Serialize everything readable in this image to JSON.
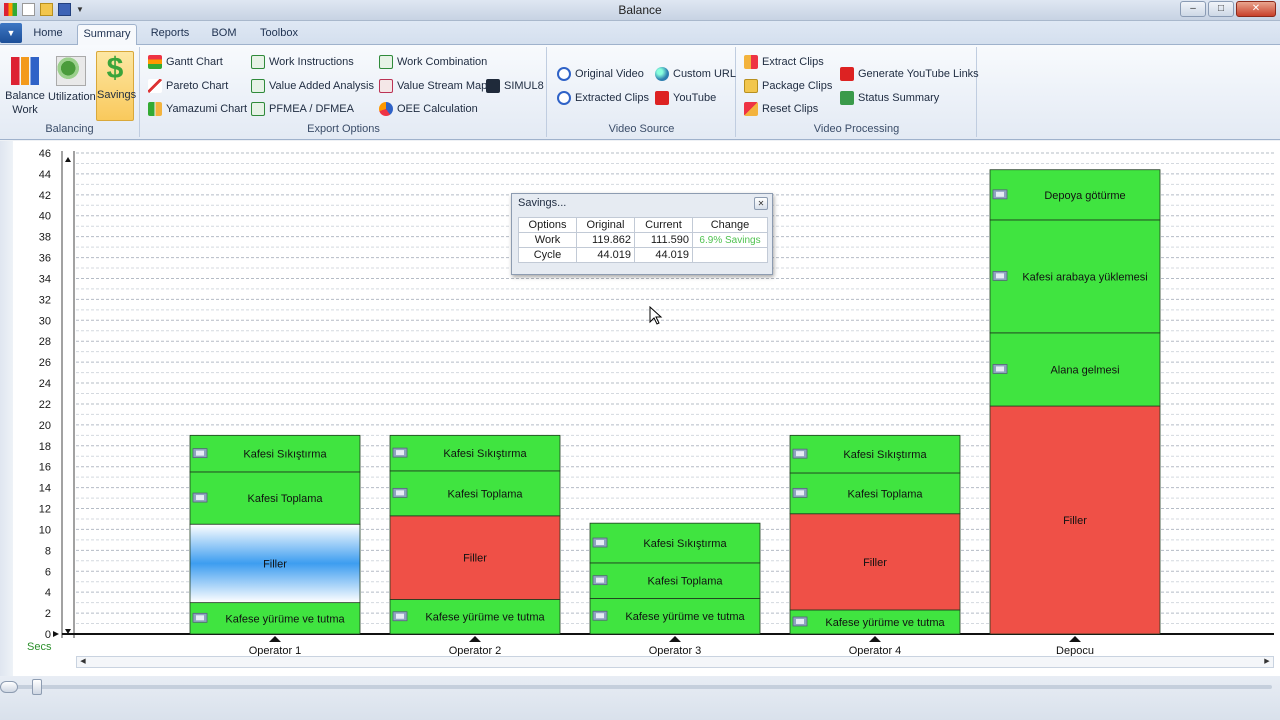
{
  "window": {
    "title": "Balance"
  },
  "colors": {
    "green": "#40e440",
    "red": "#ef5047",
    "accent": "#2a8f2a"
  },
  "tabs": [
    "Home",
    "Summary",
    "Reports",
    "BOM",
    "Toolbox"
  ],
  "active_tab": "Summary",
  "ribbon": {
    "balancing": {
      "label": "Balancing",
      "balance_work": "Balance\nWork",
      "balance_work_l1": "Balance",
      "balance_work_l2": "Work",
      "utilization": "Utilization",
      "savings": "Savings"
    },
    "export": {
      "label": "Export Options",
      "gantt": "Gantt Chart",
      "pareto": "Pareto Chart",
      "yamazumi": "Yamazumi Chart",
      "work_instructions": "Work Instructions",
      "value_added": "Value Added Analysis",
      "pfmea": "PFMEA / DFMEA",
      "work_combination": "Work Combination",
      "value_stream": "Value Stream Map",
      "oee": "OEE Calculation",
      "simul8": "SIMUL8"
    },
    "video_source": {
      "label": "Video Source",
      "original": "Original Video",
      "extracted": "Extracted Clips",
      "custom_url": "Custom URL",
      "youtube": "YouTube"
    },
    "video_processing": {
      "label": "Video Processing",
      "extract": "Extract Clips",
      "package": "Package Clips",
      "reset": "Reset Clips",
      "gen_links": "Generate YouTube Links",
      "status": "Status Summary"
    }
  },
  "savings_dialog": {
    "title": "Savings...",
    "headers": [
      "Options",
      "Original",
      "Current",
      "Change"
    ],
    "rows": [
      {
        "option": "Work",
        "original": "119.862",
        "current": "111.590",
        "change": "6.9% Savings"
      },
      {
        "option": "Cycle",
        "original": "44.019",
        "current": "44.019",
        "change": ""
      }
    ]
  },
  "chart_data": {
    "type": "bar",
    "stacked": true,
    "ylabel": "Secs",
    "ylim": [
      0,
      46
    ],
    "yticks": [
      0,
      2,
      4,
      6,
      8,
      10,
      12,
      14,
      16,
      18,
      20,
      22,
      24,
      26,
      28,
      30,
      32,
      34,
      36,
      38,
      40,
      42,
      44,
      46
    ],
    "grid": true,
    "categories": [
      "Operator 1",
      "Operator 2",
      "Operator 3",
      "Operator 4",
      "Depocu"
    ],
    "stacks": [
      {
        "category": "Operator 1",
        "segments": [
          {
            "label": "Kafese yürüme ve tutma",
            "value": 3.0,
            "kind": "work",
            "icon": "video-clip-icon"
          },
          {
            "label": "Filler",
            "value": 7.5,
            "kind": "filler-blue"
          },
          {
            "label": "Kafesi Toplama",
            "value": 5.0,
            "kind": "work",
            "icon": "video-clip-icon"
          },
          {
            "label": "Kafesi Sıkıştırma",
            "value": 3.5,
            "kind": "work",
            "icon": "video-clip-icon"
          }
        ]
      },
      {
        "category": "Operator 2",
        "segments": [
          {
            "label": "Kafese yürüme ve tutma",
            "value": 3.3,
            "kind": "work",
            "icon": "video-clip-icon"
          },
          {
            "label": "Filler",
            "value": 8.0,
            "kind": "filler"
          },
          {
            "label": "Kafesi Toplama",
            "value": 4.3,
            "kind": "work",
            "icon": "video-clip-icon"
          },
          {
            "label": "Kafesi Sıkıştırma",
            "value": 3.4,
            "kind": "work",
            "icon": "video-clip-icon"
          }
        ]
      },
      {
        "category": "Operator 3",
        "segments": [
          {
            "label": "Kafese yürüme ve tutma",
            "value": 3.4,
            "kind": "work",
            "icon": "video-clip-icon"
          },
          {
            "label": "Kafesi Toplama",
            "value": 3.4,
            "kind": "work",
            "icon": "video-clip-icon"
          },
          {
            "label": "Kafesi Sıkıştırma",
            "value": 3.8,
            "kind": "work",
            "icon": "video-clip-icon"
          }
        ]
      },
      {
        "category": "Operator 4",
        "segments": [
          {
            "label": "Kafese yürüme ve tutma",
            "value": 2.3,
            "kind": "work",
            "icon": "video-clip-icon"
          },
          {
            "label": "Filler",
            "value": 9.2,
            "kind": "filler"
          },
          {
            "label": "Kafesi Toplama",
            "value": 3.9,
            "kind": "work",
            "icon": "video-clip-icon"
          },
          {
            "label": "Kafesi Sıkıştırma",
            "value": 3.6,
            "kind": "work",
            "icon": "video-clip-icon"
          }
        ]
      },
      {
        "category": "Depocu",
        "segments": [
          {
            "label": "Filler",
            "value": 21.8,
            "kind": "filler"
          },
          {
            "label": "Alana gelmesi",
            "value": 7.0,
            "kind": "work",
            "icon": "video-clip-icon"
          },
          {
            "label": "Kafesi arabaya yüklemesi",
            "value": 10.8,
            "kind": "work",
            "icon": "video-clip-icon"
          },
          {
            "label": "Depoya götürme",
            "value": 4.8,
            "kind": "work",
            "icon": "video-clip-icon"
          }
        ]
      }
    ]
  }
}
